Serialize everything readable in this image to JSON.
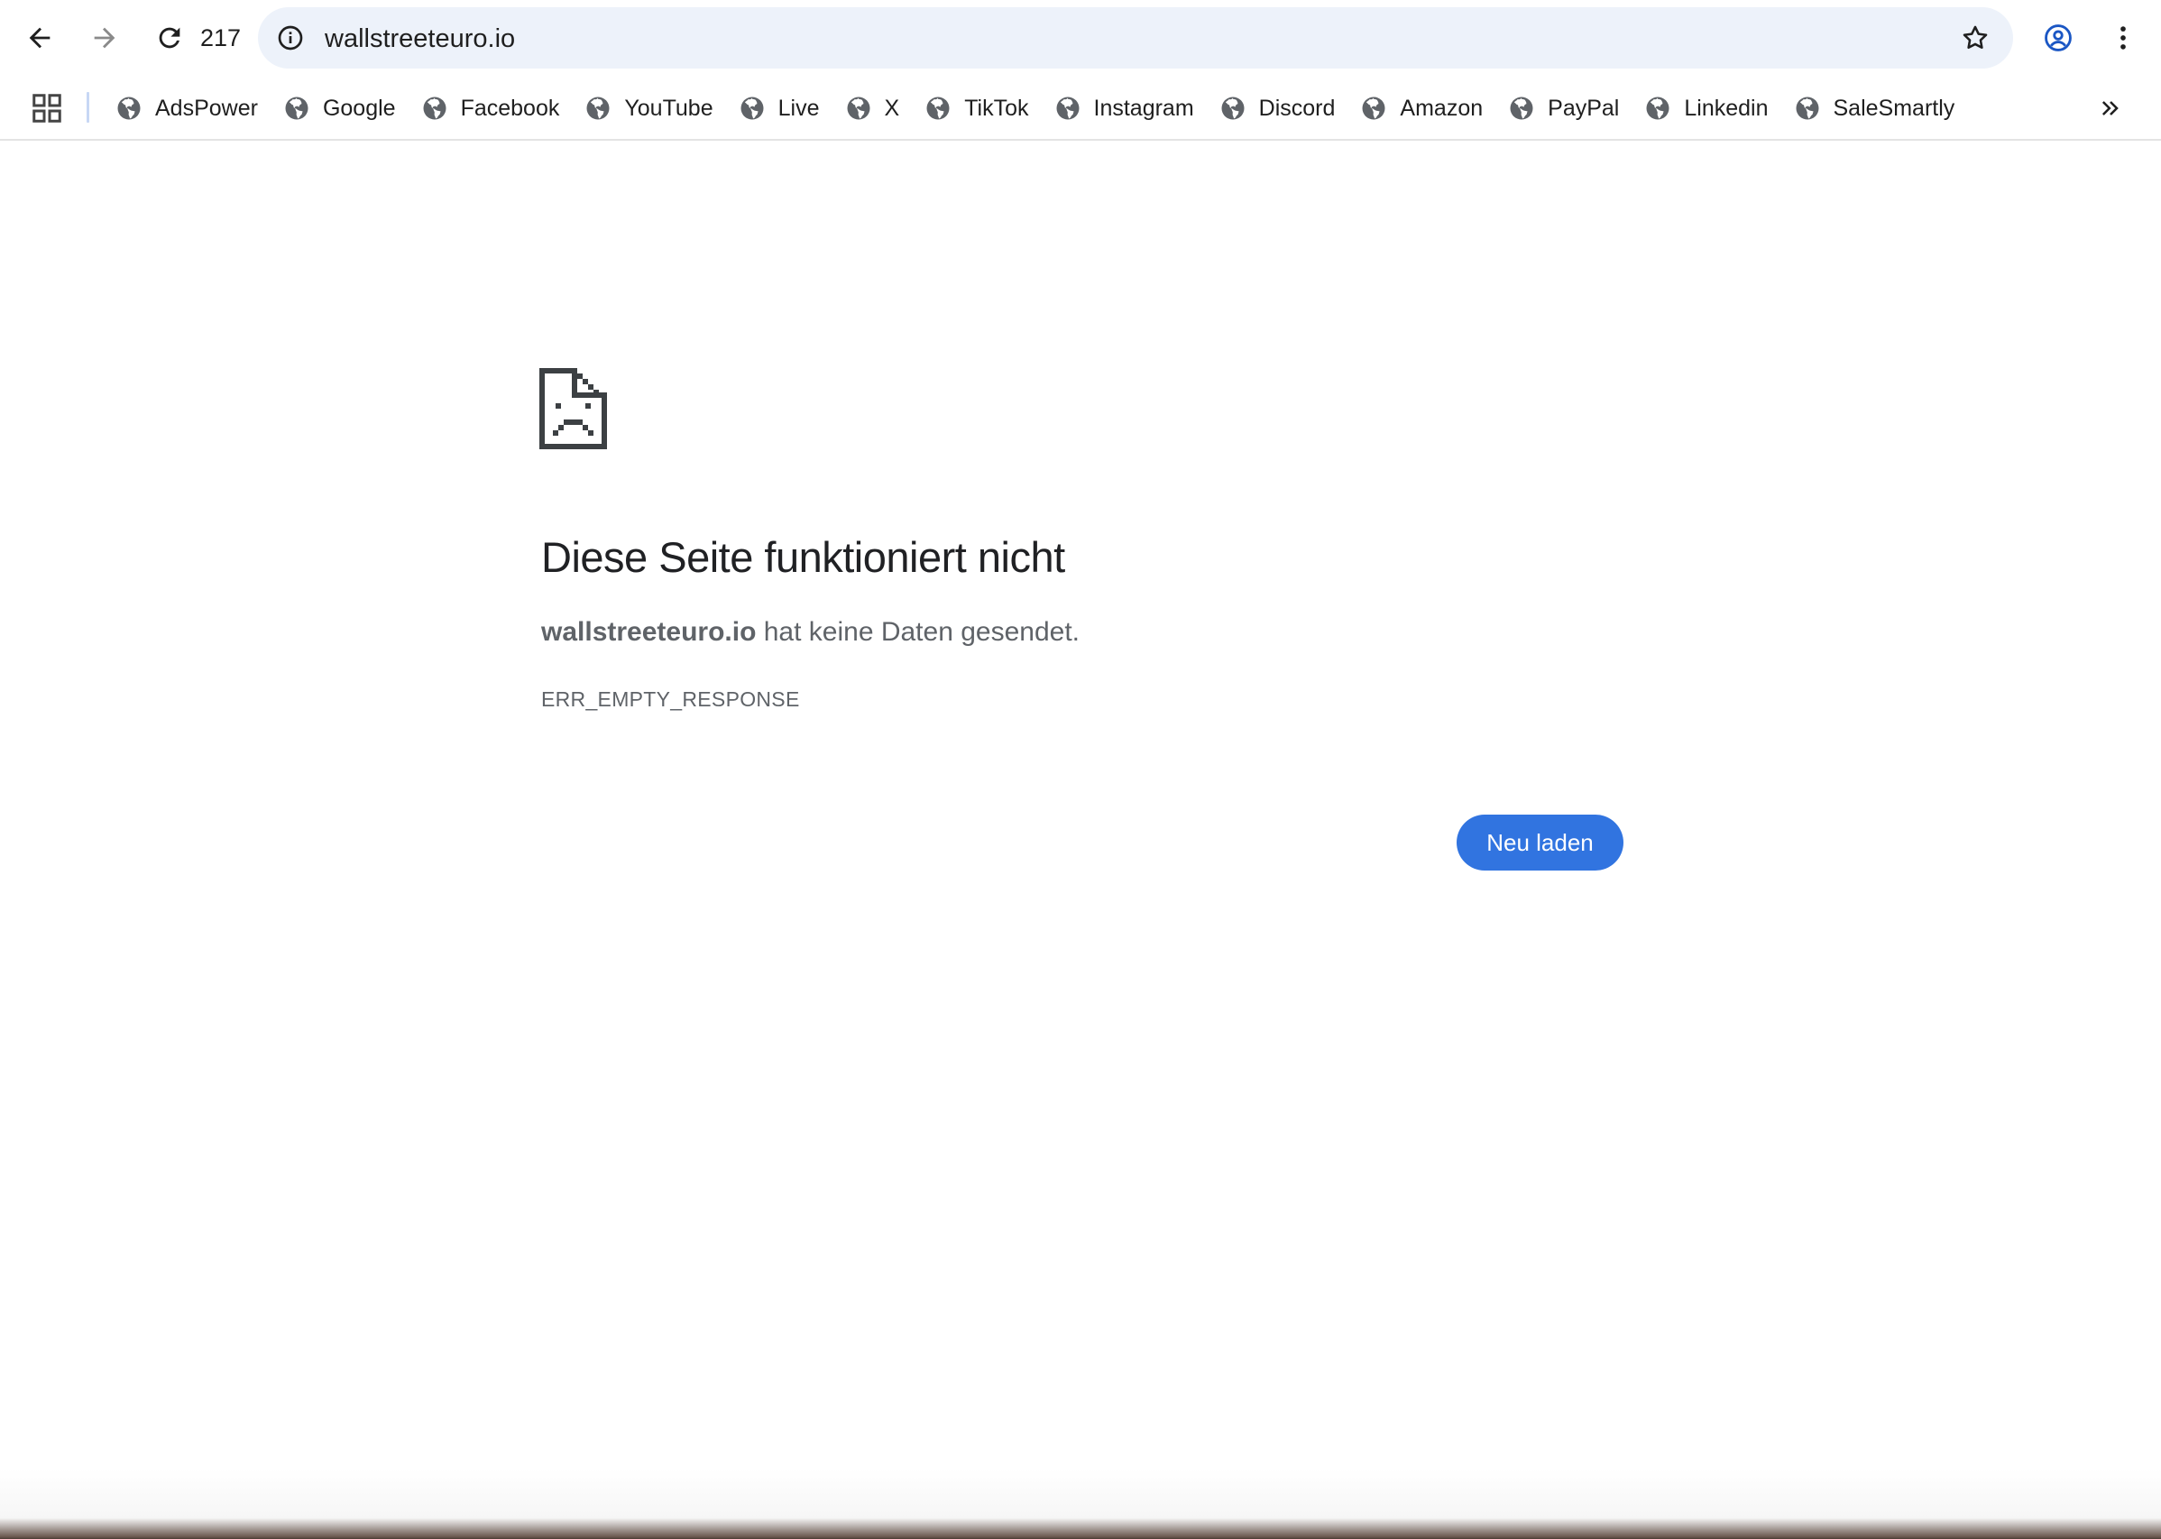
{
  "toolbar": {
    "tab_count": "217",
    "url": "wallstreeteuro.io"
  },
  "icons": {
    "back": "back-arrow-icon",
    "forward": "forward-arrow-icon",
    "reload": "reload-icon",
    "site_info": "info-icon",
    "bookmark": "star-icon",
    "profile": "profile-icon",
    "menu": "kebab-menu-icon",
    "apps": "apps-grid-icon",
    "bookmark_site": "globe-icon",
    "overflow": "double-chevron-icon"
  },
  "bookmarks": [
    {
      "label": "AdsPower"
    },
    {
      "label": "Google"
    },
    {
      "label": "Facebook"
    },
    {
      "label": "YouTube"
    },
    {
      "label": "Live"
    },
    {
      "label": "X"
    },
    {
      "label": "TikTok"
    },
    {
      "label": "Instagram"
    },
    {
      "label": "Discord"
    },
    {
      "label": "Amazon"
    },
    {
      "label": "PayPal"
    },
    {
      "label": "Linkedin"
    },
    {
      "label": "SaleSmartly"
    }
  ],
  "error": {
    "title": "Diese Seite funktioniert nicht",
    "host": "wallstreeteuro.io",
    "message": " hat keine Daten gesendet.",
    "code": "ERR_EMPTY_RESPONSE",
    "reload_label": "Neu laden"
  },
  "colors": {
    "accent": "#3174e0",
    "omnibox_bg": "#edf2fa",
    "profile": "#1a56c4"
  }
}
